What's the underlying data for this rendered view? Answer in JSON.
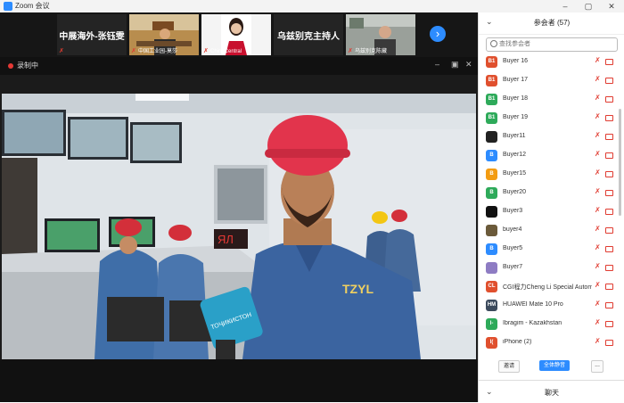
{
  "window": {
    "title": "Zoom 会议",
    "minimize": "–",
    "maximize": "▢",
    "close": "✕"
  },
  "thumbnails": [
    {
      "type": "name",
      "name": "中展海外-张钰雯"
    },
    {
      "type": "video",
      "label": "中国工业园-莫莎"
    },
    {
      "type": "video",
      "label": "ChinaCentral"
    },
    {
      "type": "name",
      "name": "乌兹别克主持人"
    },
    {
      "type": "video",
      "label": "乌兹别克陈藏"
    }
  ],
  "next_arrow": "›",
  "recording": {
    "text": "录制中"
  },
  "main_video": {
    "jacket_text": "TZYL",
    "mic_text": "ТОҶИКИСТОН"
  },
  "sidebar": {
    "title": "参会者 (57)",
    "collapse_icon": "⌄",
    "search_placeholder": "查找参会者",
    "participants": [
      {
        "initials": "B1",
        "name": "Buyer 16",
        "color": "#e0502e"
      },
      {
        "initials": "B1",
        "name": "Buyer 17",
        "color": "#e0502e"
      },
      {
        "initials": "B1",
        "name": "Buyer 18",
        "color": "#2eaa5a"
      },
      {
        "initials": "B1",
        "name": "Buyer 19",
        "color": "#2eaa5a"
      },
      {
        "initials": "",
        "name": "Buyer11",
        "color": "#222222"
      },
      {
        "initials": "B",
        "name": "Buyer12",
        "color": "#2d8cff"
      },
      {
        "initials": "B",
        "name": "Buyer15",
        "color": "#f39c12"
      },
      {
        "initials": "B",
        "name": "Buyer20",
        "color": "#2eaa5a"
      },
      {
        "initials": "",
        "name": "Buyer3",
        "color": "#111111"
      },
      {
        "initials": "",
        "name": "buyer4",
        "color": "#6b5a3a"
      },
      {
        "initials": "B",
        "name": "Buyer5",
        "color": "#2d8cff"
      },
      {
        "initials": "",
        "name": "Buyer7",
        "color": "#8e7cc3"
      },
      {
        "initials": "CL",
        "name": "CGI程力Cheng Li Special Autom...",
        "color": "#e0502e"
      },
      {
        "initials": "HM",
        "name": "HUAWEI Mate 10 Pro",
        "color": "#3c4a5c"
      },
      {
        "initials": "I-",
        "name": "Ibragim - Kazakhstan",
        "color": "#2eaa5a"
      },
      {
        "initials": "I(",
        "name": "iPhone (2)",
        "color": "#e0502e"
      }
    ],
    "actions": {
      "invite": "邀请",
      "mute_all": "全体静音",
      "more": "..."
    }
  },
  "chat": {
    "title": "聊天",
    "collapse_icon": "⌄"
  }
}
